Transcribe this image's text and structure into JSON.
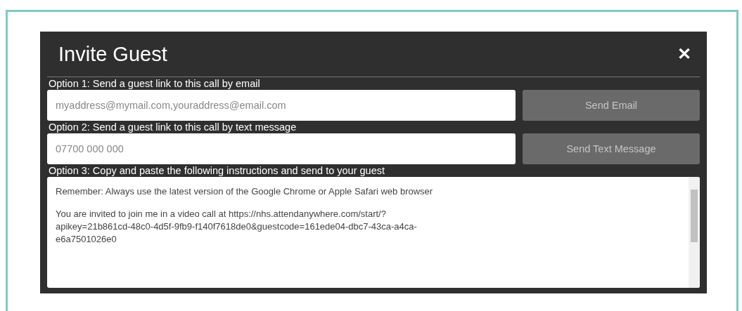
{
  "dialog": {
    "title": "Invite Guest",
    "close": "✕"
  },
  "options": [
    {
      "kind": "input",
      "label": "Option 1: Send a guest link to this call by email",
      "placeholder": "myaddress@mymail.com,youraddress@email.com",
      "button": {
        "label": "Send Email",
        "disabled": true
      }
    },
    {
      "kind": "input",
      "label": "Option 2: Send a guest link to this call by text message",
      "placeholder": "07700 000 000",
      "button": {
        "label": "Send Text Message",
        "disabled": true
      }
    },
    {
      "kind": "textarea",
      "label": "Option 3: Copy and paste the following instructions and send to your guest",
      "paragraphs": [
        [
          "Remember: Always use the latest version of the Google Chrome or Apple Safari web browser"
        ],
        [
          "You are invited to join me in a video call at https://nhs.attendanywhere.com/start/?",
          "apikey=21b861cd-48c0-4d5f-9fb9-f140f7618de0&guestcode=161ede04-dbc7-43ca-a4ca-",
          "e6a7501026e0"
        ]
      ]
    }
  ]
}
